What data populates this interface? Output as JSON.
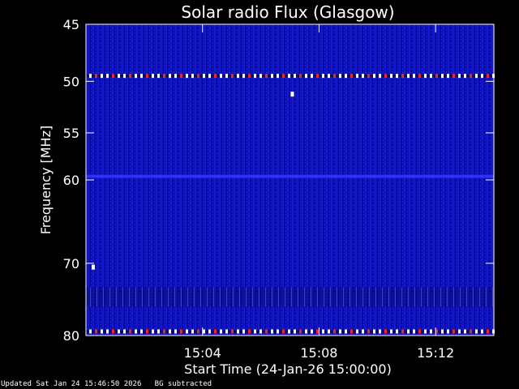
{
  "chart_data": {
    "type": "heatmap",
    "title": "Solar radio Flux (Glasgow)",
    "xlabel": "Start Time (24-Jan-26 15:00:00)",
    "ylabel": "Frequency [MHz]",
    "y_scale": "log",
    "ylim": [
      45,
      80
    ],
    "y_ticks": [
      45,
      50,
      55,
      60,
      70,
      80
    ],
    "y_tick_labels": [
      "45",
      "50",
      "55",
      "60",
      "70",
      "80"
    ],
    "xlim": [
      "15:00:00",
      "15:14:00"
    ],
    "x_ticks": [
      "15:04",
      "15:08",
      "15:12"
    ],
    "x_tick_labels": [
      "15:04",
      "15:08",
      "15:12"
    ],
    "colormap": [
      "#0a0a5a",
      "#1a1acc",
      "#3a3aff",
      "#ff2020",
      "#ffffff"
    ],
    "background_level": "low",
    "features": [
      {
        "name": "persistent interference line",
        "frequency_mhz": 49.5,
        "level": "high"
      },
      {
        "name": "enhanced band",
        "frequency_mhz": 59.6,
        "level": "medium"
      },
      {
        "name": "enhanced band",
        "frequency_mhz": 74.5,
        "level": "medium-high"
      },
      {
        "name": "persistent interference line",
        "frequency_mhz": 79.4,
        "level": "high"
      },
      {
        "name": "isolated spike",
        "time": "15:07:05",
        "frequency_mhz": 51.2,
        "level": "high"
      },
      {
        "name": "isolated spike",
        "time": "15:00:15",
        "frequency_mhz": 70.5,
        "level": "high"
      }
    ],
    "grid": false,
    "legend": "none"
  },
  "footer": {
    "updated": "Updated Sat Jan 24 15:46:50 2026",
    "note": "BG subtracted"
  }
}
